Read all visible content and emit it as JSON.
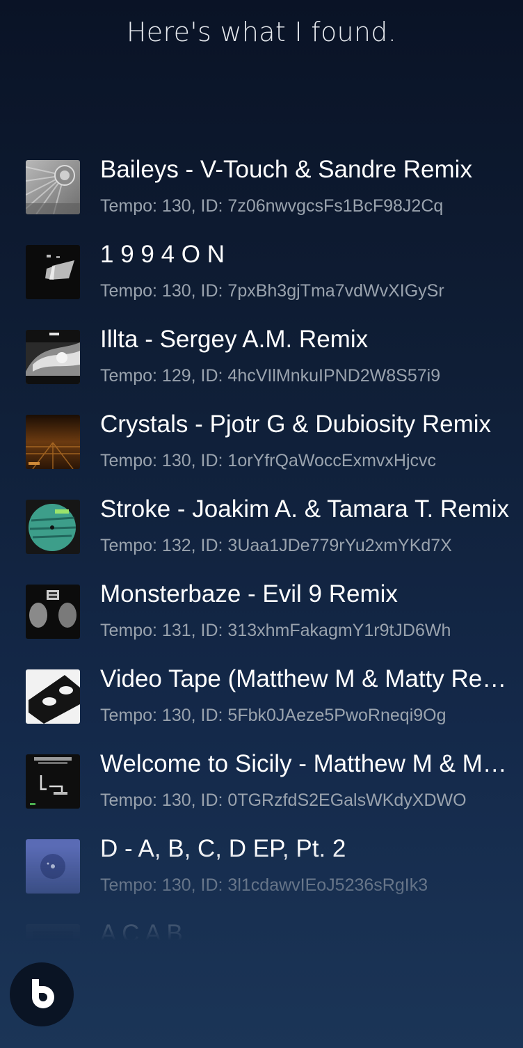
{
  "header": {
    "title": "Here's what I found."
  },
  "results": [
    {
      "title": "Baileys - V-Touch & Sandre Remix",
      "subtitle": "Tempo: 130, ID: 7z06nwvgcsFs1BcF98J2Cq",
      "art": "album-art-baileys"
    },
    {
      "title": "1 9 9 4 O N",
      "subtitle": "Tempo: 130, ID: 7pxBh3gjTma7vdWvXIGySr",
      "art": "album-art-1994on"
    },
    {
      "title": "Illta - Sergey A.M. Remix",
      "subtitle": "Tempo: 129, ID: 4hcVIlMnkuIPND2W8S57i9",
      "art": "album-art-illta"
    },
    {
      "title": "Crystals - Pjotr G & Dubiosity Remix",
      "subtitle": "Tempo: 130, ID: 1orYfrQaWoccExmvxHjcvc",
      "art": "album-art-crystals"
    },
    {
      "title": "Stroke - Joakim A. & Tamara T. Remix",
      "subtitle": "Tempo: 132, ID: 3Uaa1JDe779rYu2xmYKd7X",
      "art": "album-art-stroke"
    },
    {
      "title": "Monsterbaze - Evil 9 Remix",
      "subtitle": "Tempo: 131, ID: 313xhmFakagmY1r9tJD6Wh",
      "art": "album-art-monsterbaze"
    },
    {
      "title": "Video Tape (Matthew M & Matty Remix)",
      "subtitle": "Tempo: 130, ID: 5Fbk0JAeze5PwoRneqi9Og",
      "art": "album-art-video-tape"
    },
    {
      "title": "Welcome to Sicily - Matthew M & Matty",
      "subtitle": "Tempo: 130, ID: 0TGRzfdS2EGalsWKdyXDWO",
      "art": "album-art-sicily"
    },
    {
      "title": "D - A, B, C, D EP, Pt. 2",
      "subtitle": "Tempo: 130, ID: 3l1cdawvIEoJ5236sRgIk3",
      "art": "album-art-d"
    },
    {
      "title": "A C A B",
      "subtitle": "",
      "art": "album-art-acab"
    }
  ],
  "assistant": {
    "icon": "bixby-icon"
  }
}
